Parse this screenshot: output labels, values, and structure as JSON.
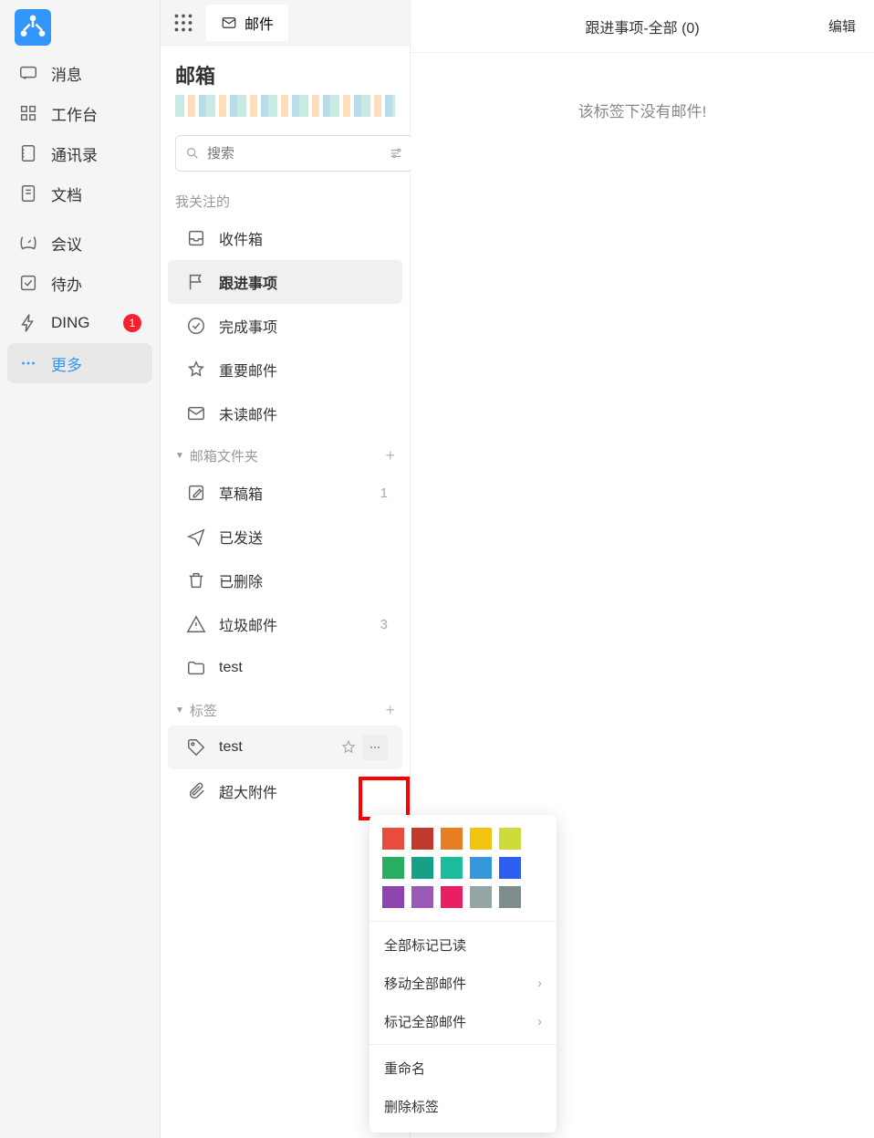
{
  "rail": {
    "items": [
      {
        "label": "消息",
        "icon": "message"
      },
      {
        "label": "工作台",
        "icon": "workbench"
      },
      {
        "label": "通讯录",
        "icon": "contacts"
      },
      {
        "label": "文档",
        "icon": "doc"
      }
    ],
    "items2": [
      {
        "label": "会议",
        "icon": "meeting"
      },
      {
        "label": "待办",
        "icon": "todo"
      },
      {
        "label": "DING",
        "icon": "ding",
        "badge": "1"
      },
      {
        "label": "更多",
        "icon": "more",
        "active": true
      }
    ]
  },
  "tab": {
    "label": "邮件"
  },
  "mail": {
    "title": "邮箱",
    "search_placeholder": "搜索",
    "compose": "+"
  },
  "sections": {
    "favorites": "我关注的",
    "folders": "邮箱文件夹",
    "tags": "标签"
  },
  "fav": [
    {
      "label": "收件箱",
      "icon": "inbox"
    },
    {
      "label": "跟进事项",
      "icon": "flag",
      "selected": true
    },
    {
      "label": "完成事项",
      "icon": "check"
    },
    {
      "label": "重要邮件",
      "icon": "star"
    },
    {
      "label": "未读邮件",
      "icon": "mail"
    }
  ],
  "folders": [
    {
      "label": "草稿箱",
      "icon": "draft",
      "count": "1"
    },
    {
      "label": "已发送",
      "icon": "sent"
    },
    {
      "label": "已删除",
      "icon": "trash"
    },
    {
      "label": "垃圾邮件",
      "icon": "spam",
      "count": "3"
    },
    {
      "label": "test",
      "icon": "folder"
    }
  ],
  "tags": [
    {
      "label": "test",
      "icon": "tag",
      "more": true
    }
  ],
  "attach": {
    "label": "超大附件",
    "icon": "attach"
  },
  "content": {
    "title": "跟进事项-全部 (0)",
    "edit": "编辑",
    "empty": "该标签下没有邮件!"
  },
  "ctx": {
    "colors": [
      "#e74c3c",
      "#c0392b",
      "#e67e22",
      "#f1c40f",
      "#cddc39",
      "#27ae60",
      "#16a085",
      "#1abc9c",
      "#3498db",
      "#2c5ff1",
      "#8e44ad",
      "#9b59b6",
      "#e91e63",
      "#95a5a6",
      "#7f8c8d"
    ],
    "mark_read": "全部标记已读",
    "move_all": "移动全部邮件",
    "tag_all": "标记全部邮件",
    "rename": "重命名",
    "delete": "删除标签"
  }
}
